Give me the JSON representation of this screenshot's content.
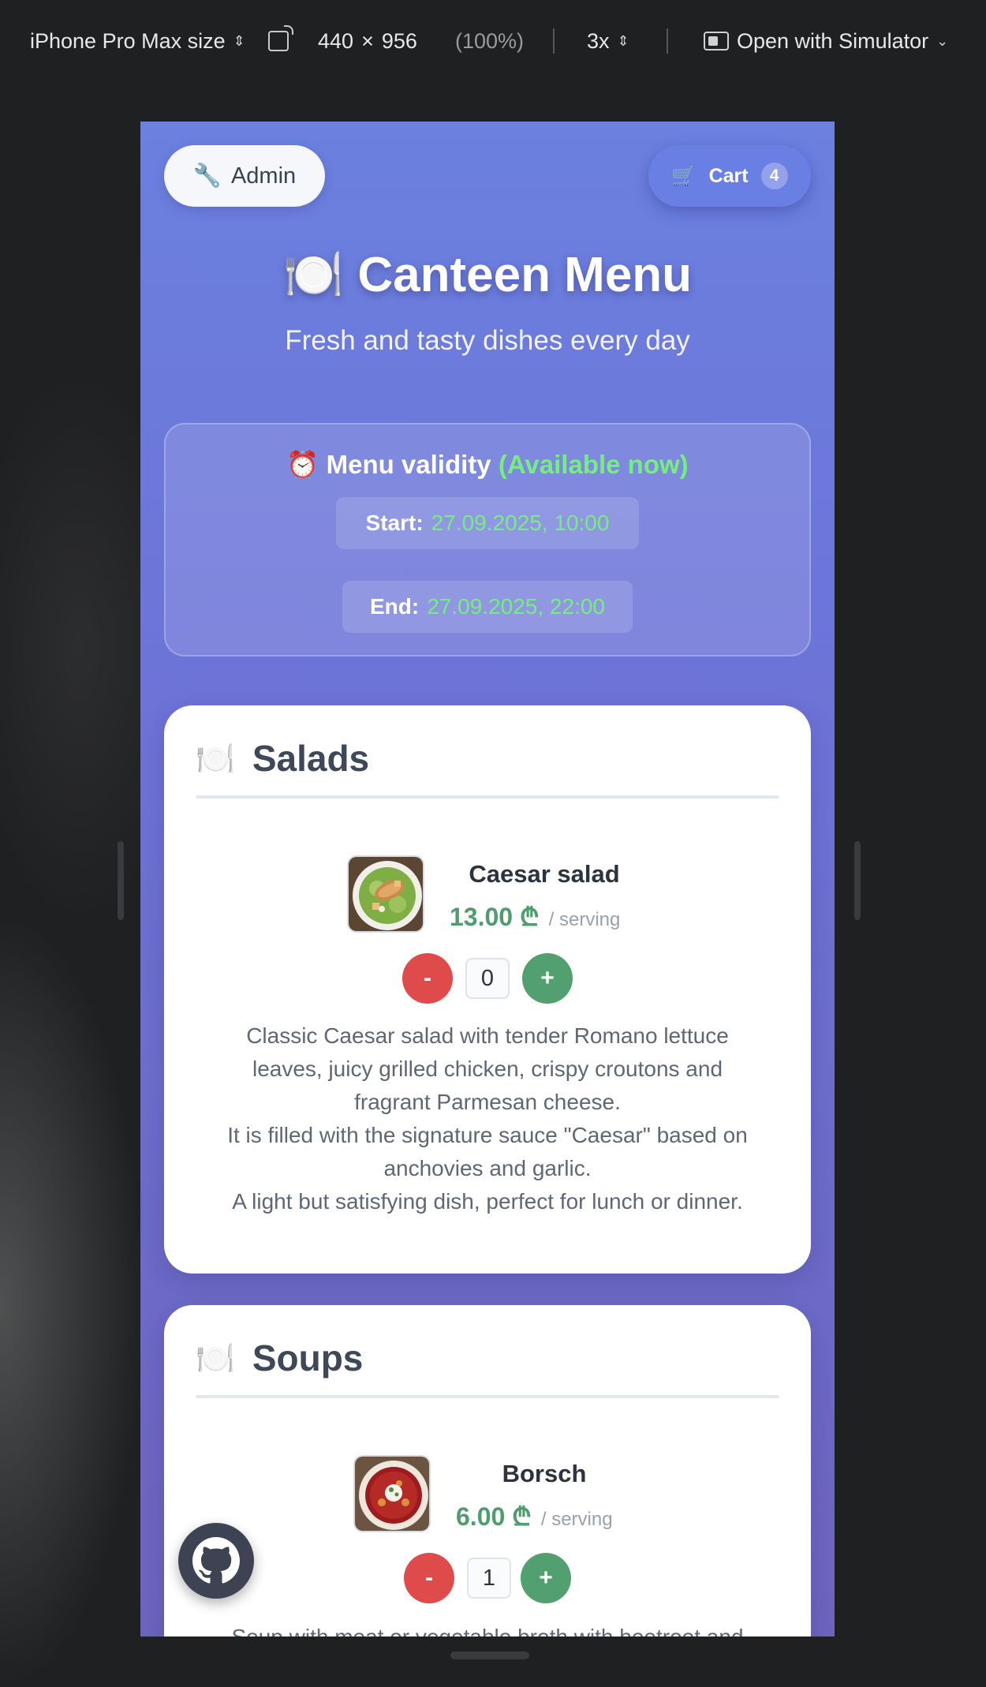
{
  "toolbar": {
    "device": "iPhone Pro Max size",
    "width": "440",
    "times": "×",
    "height": "956",
    "zoom": "(100%)",
    "scale": "3x",
    "open_with": "Open with Simulator"
  },
  "header": {
    "admin_icon": "🔧",
    "admin_label": "Admin",
    "cart_icon": "🛒",
    "cart_label": "Cart",
    "cart_count": "4",
    "title": "🍽️ Canteen Menu",
    "subtitle": "Fresh and tasty dishes every day"
  },
  "validity": {
    "icon": "⏰",
    "title": "Menu validity",
    "status": "(Available now)",
    "start_label": "Start:",
    "start_value": "27.09.2025, 10:00",
    "end_label": "End:",
    "end_value": "27.09.2025, 22:00"
  },
  "categories": [
    {
      "icon": "🍽️",
      "name": "Salads",
      "dish": {
        "name": "Caesar salad",
        "price": "13.00 ₾",
        "unit": "/ serving",
        "qty_minus": "-",
        "qty": "0",
        "qty_plus": "+",
        "desc": [
          "Classic Caesar salad with tender Romano lettuce",
          "leaves, juicy grilled chicken, crispy croutons and",
          "fragrant Parmesan cheese.",
          "It is filled with the signature sauce \"Caesar\" based on",
          "anchovies and garlic.",
          "A light but satisfying dish, perfect for lunch or dinner."
        ]
      }
    },
    {
      "icon": "🍽️",
      "name": "Soups",
      "dish": {
        "name": "Borsch",
        "price": "6.00 ₾",
        "unit": "/ serving",
        "qty_minus": "-",
        "qty": "1",
        "qty_plus": "+",
        "desc": [
          "Soup with meat or vegetable broth with beetroot and"
        ]
      }
    }
  ],
  "colors": {
    "accent": "#6b7ee0",
    "available": "#74ef7e",
    "price": "#4f9c6e",
    "minus": "#df4a4b",
    "plus": "#52a06f"
  },
  "icons": {
    "github": "github-icon"
  }
}
